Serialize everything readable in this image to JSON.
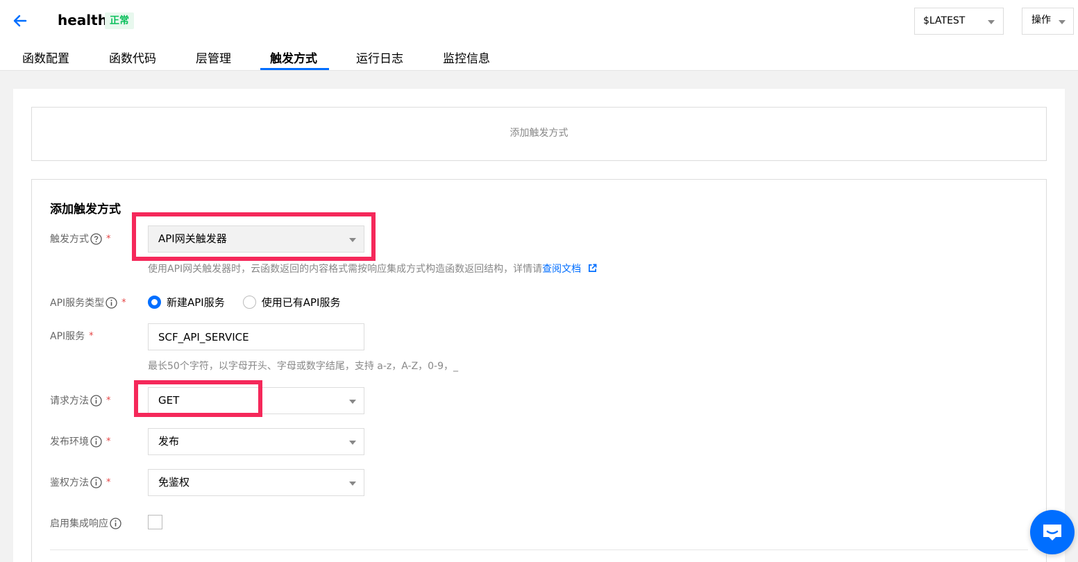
{
  "header": {
    "title": "health",
    "status": "正常",
    "version_select": "$LATEST",
    "ops_select": "操作"
  },
  "tabs": [
    {
      "label": "函数配置",
      "active": false
    },
    {
      "label": "函数代码",
      "active": false
    },
    {
      "label": "层管理",
      "active": false
    },
    {
      "label": "触发方式",
      "active": true
    },
    {
      "label": "运行日志",
      "active": false
    },
    {
      "label": "监控信息",
      "active": false
    }
  ],
  "add_trigger_button": "添加触发方式",
  "form": {
    "title": "添加触发方式",
    "trigger_type": {
      "label": "触发方式",
      "value": "API网关触发器",
      "help_prefix": "使用API网关触发器时，云函数返回的内容格式需按响应集成方式构造函数返回结构，详情请",
      "help_link": "查阅文档"
    },
    "api_service_type": {
      "label": "API服务类型",
      "options": [
        "新建API服务",
        "使用已有API服务"
      ],
      "selected": "新建API服务"
    },
    "api_service": {
      "label": "API服务",
      "value": "SCF_API_SERVICE",
      "help": "最长50个字符，以字母开头、字母或数字结尾，支持 a-z，A-Z，0-9，_"
    },
    "request_method": {
      "label": "请求方法",
      "value": "GET"
    },
    "publish_env": {
      "label": "发布环境",
      "value": "发布"
    },
    "auth_method": {
      "label": "鉴权方法",
      "value": "免鉴权"
    },
    "integration_response": {
      "label": "启用集成响应",
      "checked": false
    }
  },
  "colors": {
    "accent": "#006eff",
    "highlight": "#f5285a",
    "status_green": "#0abf5b",
    "required": "#e54545"
  }
}
